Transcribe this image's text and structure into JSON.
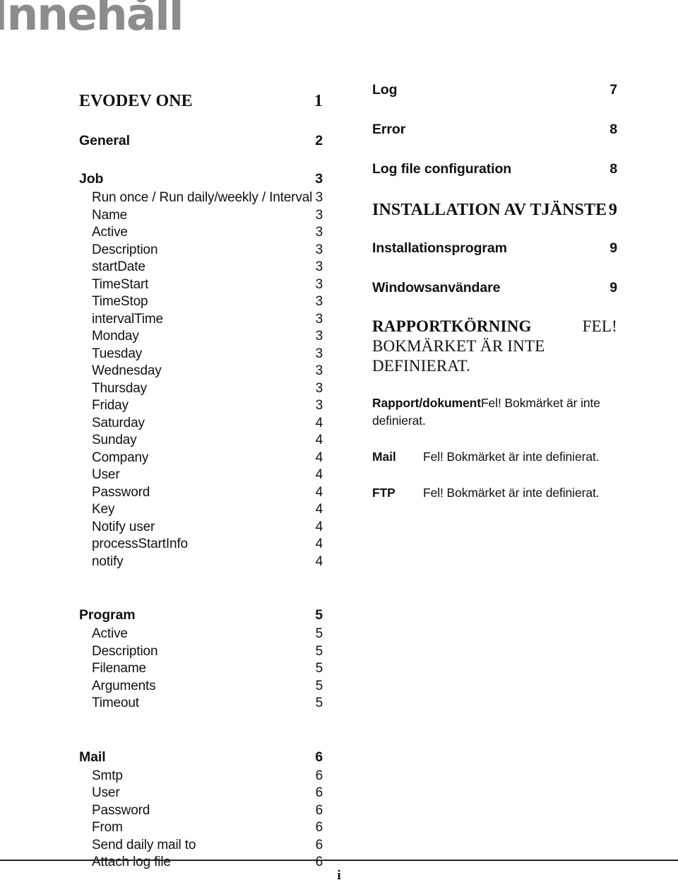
{
  "logo": {
    "text": "Innehåll"
  },
  "toc": {
    "left_column": [
      {
        "level": "1-serif",
        "label": "EVODEV ONE",
        "page": "1"
      },
      {
        "level": "gap-md"
      },
      {
        "level": "1",
        "label": "General",
        "page": "2"
      },
      {
        "level": "gap-md"
      },
      {
        "level": "1",
        "label": "Job",
        "page": "3"
      },
      {
        "level": "2",
        "label": "Run once / Run daily/weekly / Interval",
        "page": "3"
      },
      {
        "level": "2",
        "label": "Name",
        "page": "3"
      },
      {
        "level": "2",
        "label": "Active",
        "page": "3"
      },
      {
        "level": "2",
        "label": "Description",
        "page": "3"
      },
      {
        "level": "2",
        "label": "startDate",
        "page": "3"
      },
      {
        "level": "2",
        "label": "TimeStart",
        "page": "3"
      },
      {
        "level": "2",
        "label": "TimeStop",
        "page": "3"
      },
      {
        "level": "2",
        "label": "intervalTime",
        "page": "3"
      },
      {
        "level": "2",
        "label": "Monday",
        "page": "3"
      },
      {
        "level": "2",
        "label": "Tuesday",
        "page": "3"
      },
      {
        "level": "2",
        "label": "Wednesday",
        "page": "3"
      },
      {
        "level": "2",
        "label": "Thursday",
        "page": "3"
      },
      {
        "level": "2",
        "label": "Friday",
        "page": "3"
      },
      {
        "level": "2",
        "label": "Saturday",
        "page": "4"
      },
      {
        "level": "2",
        "label": "Sunday",
        "page": "4"
      },
      {
        "level": "2",
        "label": "Company",
        "page": "4"
      },
      {
        "level": "2",
        "label": "User",
        "page": "4"
      },
      {
        "level": "2",
        "label": "Password",
        "page": "4"
      },
      {
        "level": "2",
        "label": "Key",
        "page": "4"
      },
      {
        "level": "2",
        "label": "Notify user",
        "page": "4"
      },
      {
        "level": "2",
        "label": "processStartInfo",
        "page": "4"
      },
      {
        "level": "2",
        "label": "notify",
        "page": "4"
      },
      {
        "level": "gap-lg"
      },
      {
        "level": "1",
        "label": "Program",
        "page": "5"
      },
      {
        "level": "2",
        "label": "Active",
        "page": "5"
      },
      {
        "level": "2",
        "label": "Description",
        "page": "5"
      },
      {
        "level": "2",
        "label": "Filename",
        "page": "5"
      },
      {
        "level": "2",
        "label": "Arguments",
        "page": "5"
      },
      {
        "level": "2",
        "label": "Timeout",
        "page": "5"
      },
      {
        "level": "gap-lg"
      },
      {
        "level": "1",
        "label": "Mail",
        "page": "6"
      },
      {
        "level": "2",
        "label": "Smtp",
        "page": "6"
      },
      {
        "level": "2",
        "label": "User",
        "page": "6"
      },
      {
        "level": "2",
        "label": "Password",
        "page": "6"
      },
      {
        "level": "2",
        "label": "From",
        "page": "6"
      },
      {
        "level": "2",
        "label": "Send daily mail to",
        "page": "6"
      },
      {
        "level": "2",
        "label": "Attach log file",
        "page": "6"
      }
    ],
    "right_column": [
      {
        "level": "1",
        "label": "Log",
        "page": "7"
      },
      {
        "level": "1",
        "label": "Error",
        "page": "8"
      },
      {
        "level": "1",
        "label": "Log file configuration",
        "page": "8"
      },
      {
        "level": "1-serif",
        "label": "INSTALLATION AV TJÄNSTEN",
        "page": "9"
      },
      {
        "level": "1",
        "label": "Installationsprogram",
        "page": "9"
      },
      {
        "level": "1",
        "label": "Windowsanvändare",
        "page": "9"
      }
    ]
  },
  "broken_reference": {
    "heading_bold": "RAPPORTKÖRNING",
    "heading_trailing": "FEL!",
    "heading_rest": "BOKMÄRKET ÄR INTE DEFINIERAT.",
    "paragraph_bold": "Rapport/dokument",
    "paragraph_rest": "Fel! Bokmärket är inte definierat.",
    "rows": [
      {
        "key": "Mail",
        "value": "Fel! Bokmärket är inte definierat."
      },
      {
        "key": "FTP",
        "value": "Fel! Bokmärket är inte definierat."
      }
    ]
  },
  "footer": {
    "page_number": "i"
  }
}
